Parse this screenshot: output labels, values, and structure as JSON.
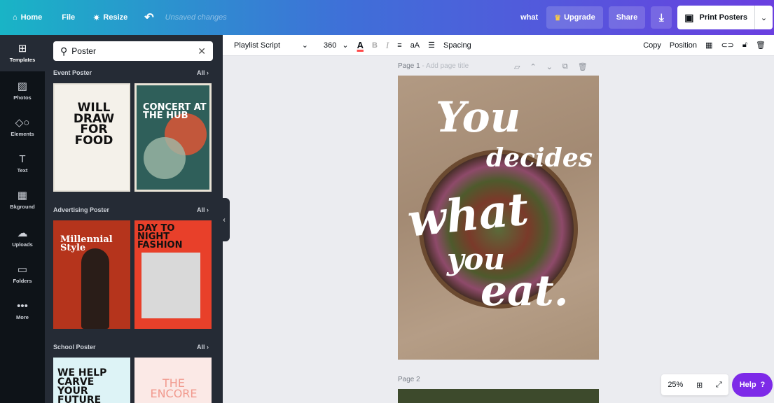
{
  "topbar": {
    "home": "Home",
    "file": "File",
    "resize": "Resize",
    "unsaved": "Unsaved changes",
    "design_title": "what",
    "upgrade": "Upgrade",
    "share": "Share",
    "print": "Print Posters"
  },
  "rail": {
    "items": [
      {
        "label": "Templates",
        "icon": "templates-icon"
      },
      {
        "label": "Photos",
        "icon": "photos-icon"
      },
      {
        "label": "Elements",
        "icon": "elements-icon"
      },
      {
        "label": "Text",
        "icon": "text-icon"
      },
      {
        "label": "Bkground",
        "icon": "background-icon"
      },
      {
        "label": "Uploads",
        "icon": "uploads-icon"
      },
      {
        "label": "Folders",
        "icon": "folders-icon"
      },
      {
        "label": "More",
        "icon": "more-icon"
      }
    ]
  },
  "panel": {
    "search_value": "Poster",
    "sections": [
      {
        "title": "Event Poster",
        "all": "All"
      },
      {
        "title": "Advertising Poster",
        "all": "All"
      },
      {
        "title": "School Poster",
        "all": "All"
      }
    ],
    "templates": {
      "will_draw": "WILL DRAW FOR FOOD",
      "concert": "CONCERT AT THE HUB",
      "millennial": "Millennial Style",
      "day_night": "DAY TO NIGHT FASHION",
      "we_help": "WE HELP CARVE YOUR FUTURE",
      "encore": "THE ENCORE"
    }
  },
  "toolbar": {
    "font_family": "Playlist Script",
    "font_size": "360",
    "color_glyph": "A",
    "bold_glyph": "B",
    "italic_glyph": "I",
    "case_glyph": "aA",
    "spacing": "Spacing",
    "copy": "Copy",
    "position": "Position"
  },
  "canvas": {
    "page1_label": "Page 1",
    "page1_title_placeholder": "- Add page title",
    "page2_label": "Page 2",
    "poster_lines": [
      "You",
      "decides",
      "what",
      "you",
      "eat."
    ]
  },
  "zoom": {
    "value": "25%"
  },
  "help": {
    "label": "Help",
    "glyph": "?"
  },
  "colors": {
    "accent": "#7d2ae8",
    "panel": "#252b35",
    "rail": "#0e1318"
  }
}
